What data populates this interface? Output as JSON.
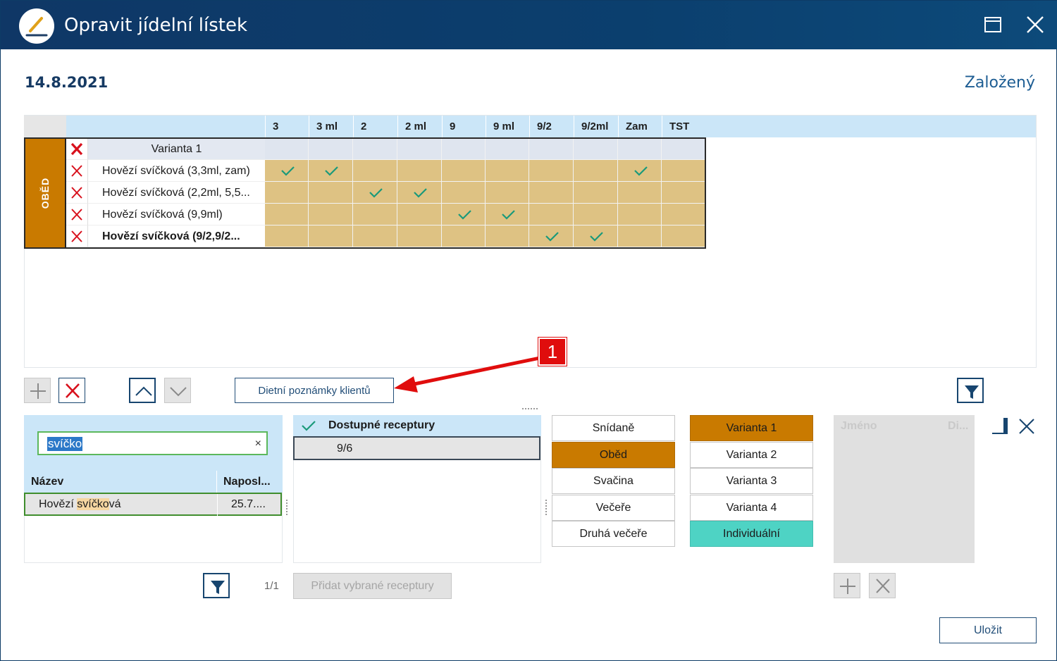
{
  "window": {
    "title": "Opravit jídelní lístek"
  },
  "header": {
    "date": "14.8.2021",
    "status": "Založený"
  },
  "grid": {
    "columns": [
      "3",
      "3 ml",
      "2",
      "2 ml",
      "9",
      "9 ml",
      "9/2",
      "9/2ml",
      "Zam",
      "TST"
    ],
    "meal_label": "OBĚD",
    "rows": [
      {
        "name": "Varianta 1",
        "checks": []
      },
      {
        "name": "Hovězí svíčková (3,3ml, zam)",
        "checks": [
          0,
          1,
          8
        ]
      },
      {
        "name": "Hovězí svíčková (2,2ml, 5,5...",
        "checks": [
          2,
          3
        ]
      },
      {
        "name": "Hovězí svíčková (9,9ml)",
        "checks": [
          4,
          5
        ]
      },
      {
        "name": "Hovězí svíčková (9/2,9/2...",
        "checks": [
          6,
          7
        ]
      }
    ]
  },
  "toolbar": {
    "diet_notes_label": "Dietní poznámky klientů"
  },
  "callout": {
    "number": "1"
  },
  "search": {
    "value": "svíčko",
    "clear_symbol": "×",
    "columns": [
      "Název",
      "Naposl..."
    ],
    "result": {
      "name_prefix": "Hovězí ",
      "name_highlight": "svíčko",
      "name_suffix": "vá",
      "date": "25.7...."
    }
  },
  "recipes": {
    "header": "Dostupné receptury",
    "items": [
      "9/6"
    ]
  },
  "meals": {
    "options": [
      "Snídaně",
      "Oběd",
      "Svačina",
      "Večeře",
      "Druhá večeře"
    ],
    "selected": "Oběd"
  },
  "variants": {
    "options": [
      "Varianta 1",
      "Varianta 2",
      "Varianta 3",
      "Varianta 4",
      "Individuální"
    ],
    "selected": "Varianta 1"
  },
  "clients": {
    "columns": [
      "Jméno",
      "Di..."
    ]
  },
  "pager": {
    "text": "1/1"
  },
  "actions": {
    "add_recipes": "Přidat vybrané receptury",
    "save": "Uložit"
  },
  "colors": {
    "titlebar": "#0f3766",
    "accent_orange": "#c97a00",
    "teal": "#4ed3c4",
    "header_blue": "#cbe6f8",
    "cell_tan": "#dec283",
    "check_green": "#1a9a7a"
  },
  "icons": [
    "pencil-icon",
    "maximize-icon",
    "close-icon",
    "delete-icon",
    "plus-icon",
    "chevron-up-icon",
    "chevron-down-icon",
    "filter-icon",
    "check-icon"
  ]
}
